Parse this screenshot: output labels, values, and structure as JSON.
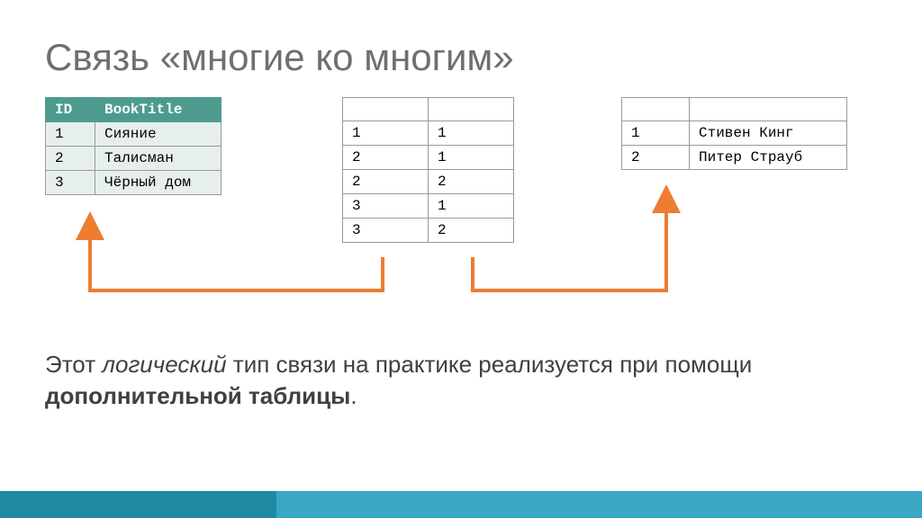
{
  "title": "Связь «многие ко многим»",
  "books": {
    "headers": {
      "id": "ID",
      "title": "BookTitle"
    },
    "rows": [
      {
        "id": "1",
        "title": "Сияние"
      },
      {
        "id": "2",
        "title": "Талисман"
      },
      {
        "id": "3",
        "title": "Чёрный дом"
      }
    ]
  },
  "junction": {
    "rows": [
      {
        "a": "1",
        "b": "1"
      },
      {
        "a": "2",
        "b": "1"
      },
      {
        "a": "2",
        "b": "2"
      },
      {
        "a": "3",
        "b": "1"
      },
      {
        "a": "3",
        "b": "2"
      }
    ]
  },
  "authors": {
    "rows": [
      {
        "id": "1",
        "name": "Стивен Кинг"
      },
      {
        "id": "2",
        "name": "Питер Страуб"
      }
    ]
  },
  "body": {
    "pre": "Этот ",
    "italic": "логический",
    "mid": " тип связи на практике реализуется при помощи ",
    "bold": "дополнительной таблицы",
    "post": "."
  },
  "connector_color": "#ed7d31"
}
